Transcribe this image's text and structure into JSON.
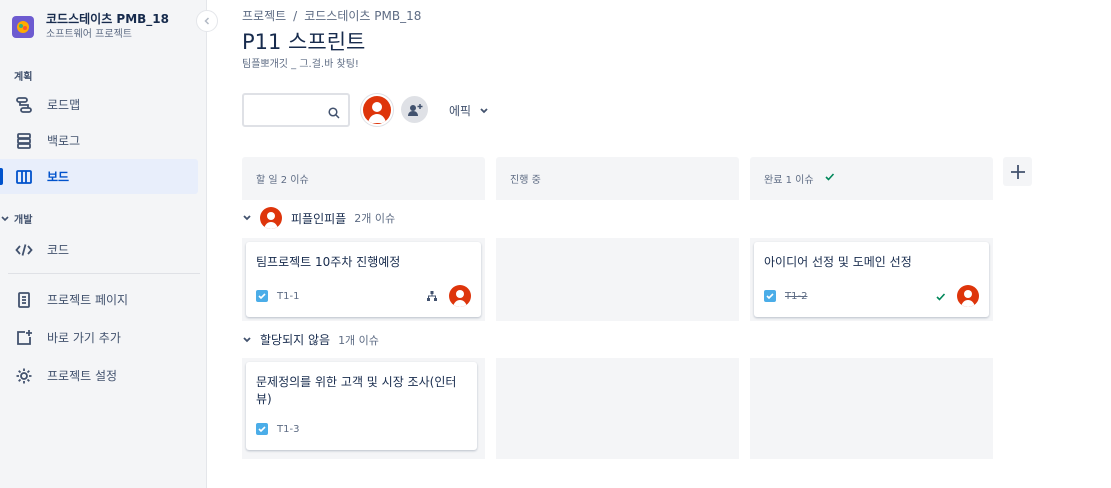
{
  "project": {
    "name": "코드스테이츠 PMB_18",
    "type": "소프트웨어 프로젝트"
  },
  "sidebar": {
    "section_plan": "계획",
    "section_dev": "개발",
    "items": [
      {
        "label": "로드맵",
        "icon": "roadmap-icon"
      },
      {
        "label": "백로그",
        "icon": "backlog-icon"
      },
      {
        "label": "보드",
        "icon": "board-icon",
        "active": true
      },
      {
        "label": "코드",
        "icon": "code-icon"
      },
      {
        "label": "프로젝트 페이지",
        "icon": "page-icon"
      },
      {
        "label": "바로 가기 추가",
        "icon": "add-shortcut-icon"
      },
      {
        "label": "프로젝트 설정",
        "icon": "gear-icon"
      }
    ]
  },
  "breadcrumb": {
    "root": "프로젝트",
    "separator": "/",
    "project": "코드스테이츠 PMB_18"
  },
  "page": {
    "title": "P11 스프린트",
    "goal": "팀플뽀개깃 _ 그.걸.바 찾팅!"
  },
  "toolbar": {
    "search_placeholder": "",
    "epic_label": "에픽"
  },
  "columns": [
    {
      "title": "할 일 2 이슈"
    },
    {
      "title": "진행 중"
    },
    {
      "title": "완료 1 이슈",
      "done_check": true
    }
  ],
  "swimlanes": [
    {
      "name": "피플인피플",
      "count": "2개 이슈"
    },
    {
      "name": "할당되지 않음",
      "count": "1개 이슈"
    }
  ],
  "cards": [
    {
      "summary": "팀프로젝트 10주차 진행예정",
      "key": "T1-1"
    },
    {
      "summary": "아이디어 선정 및 도메인 선정",
      "key": "T1-2",
      "done": true
    },
    {
      "summary": "문제정의를 위한 고객 및 시장 조사(인터뷰)",
      "key": "T1-3"
    }
  ],
  "colors": {
    "accent": "#0052cc",
    "avatar": "#de350b",
    "story_check": "#4bade8",
    "done": "#00875a"
  }
}
